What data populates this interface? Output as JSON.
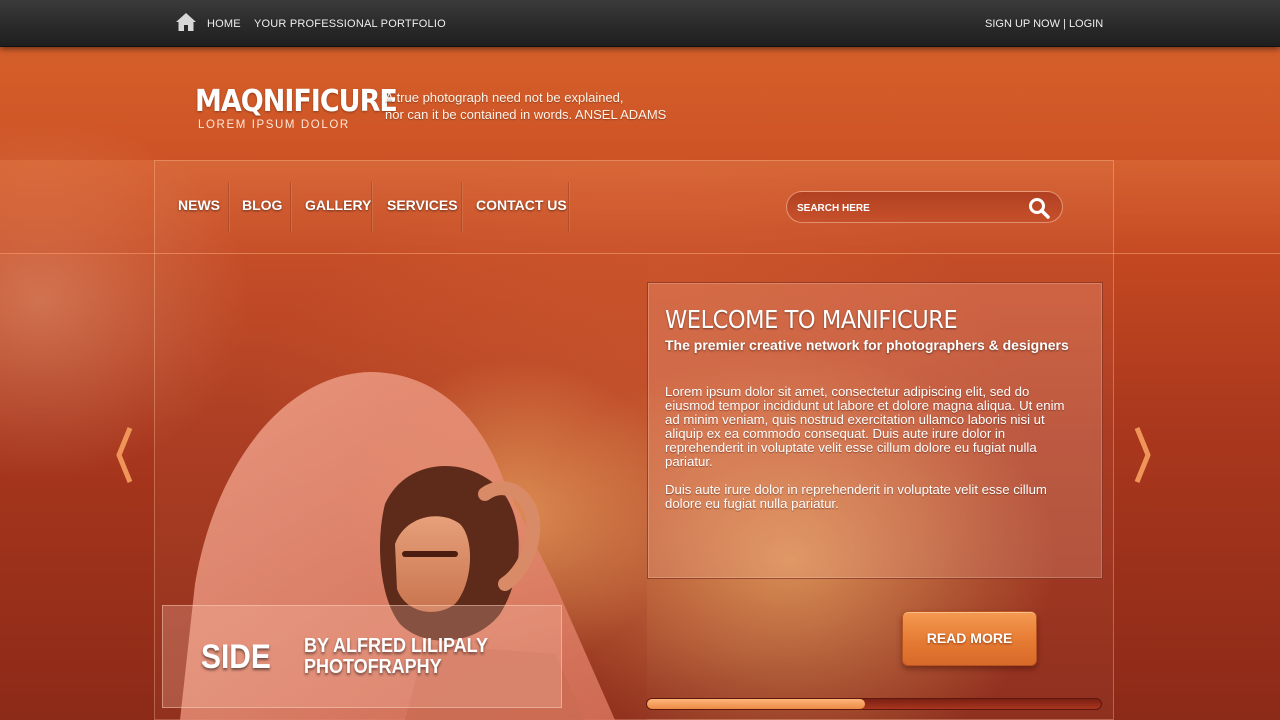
{
  "topbar": {
    "home_label": "HOME",
    "portfolio_label": "YOUR PROFESSIONAL PORTFOLIO",
    "auth_label": "SIGN UP NOW | LOGIN"
  },
  "header": {
    "logo_title": "MAQNIFICURE",
    "logo_subtitle": "LOREM IPSUM DOLOR",
    "quote_lines": [
      "A true photograph need not be explained,",
      "nor can it be contained in words. ANSEL ADAMS"
    ]
  },
  "nav": {
    "items": [
      {
        "label": "NEWS"
      },
      {
        "label": "BLOG"
      },
      {
        "label": "GALLERY"
      },
      {
        "label": "SERVICES"
      },
      {
        "label": "CONTACT US"
      }
    ]
  },
  "search": {
    "placeholder": "SEARCH HERE",
    "value": ""
  },
  "welcome": {
    "title": "WELCOME TO MANIFICURE",
    "subtitle": "The premier creative network for photographers & designers",
    "paragraph_1": "Lorem ipsum dolor sit amet, consectetur adipiscing elit, sed do eiusmod tempor incididunt ut labore et dolore magna aliqua. Ut enim ad minim veniam, quis nostrud exercitation ullamco laboris nisi ut aliquip ex ea commodo consequat. Duis aute irure dolor in reprehenderit in voluptate velit esse cillum dolore eu fugiat nulla pariatur.",
    "paragraph_2": "Duis aute irure dolor in reprehenderit in voluptate velit esse cillum dolore eu fugiat nulla pariatur.",
    "read_more_label": "READ MORE"
  },
  "slide": {
    "caption_side": "SIDE",
    "caption_credit_lines": [
      "BY ALFRED LILIPALY",
      "PHOTOFRAPHY"
    ],
    "progress_fraction": 0.48
  },
  "colors": {
    "accent": "#e8813c",
    "background": "#c94c22",
    "topbar": "#2a2a2a"
  },
  "icons": {
    "home": "home-icon",
    "search": "search-icon",
    "prev": "chevron-left-icon",
    "next": "chevron-right-icon"
  }
}
